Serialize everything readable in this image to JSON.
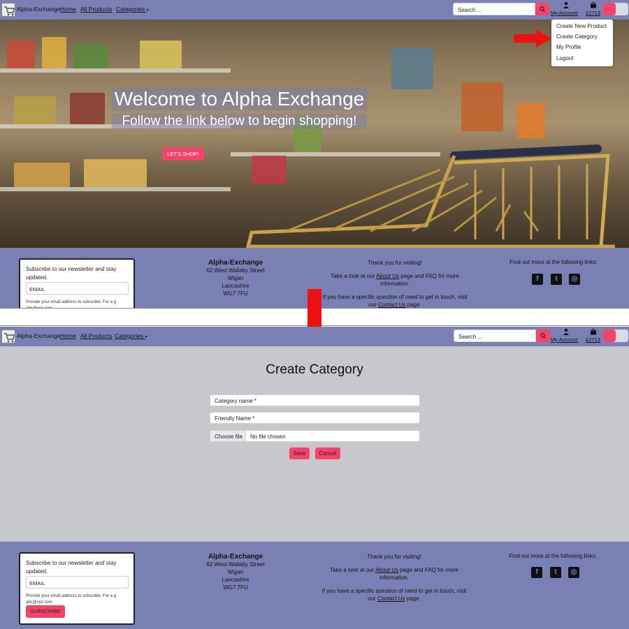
{
  "nav": {
    "brand": "Alpha-Exchange",
    "links": [
      "Home",
      "All Products",
      "Categories"
    ],
    "search_placeholder": "Search ...",
    "account_label": "My Account",
    "bag_label": "£2713"
  },
  "dropdown": {
    "items": [
      "Create New Product",
      "Create Category",
      "My Profile",
      "Logout"
    ]
  },
  "hero": {
    "title": "Welcome to Alpha Exchange",
    "subtitle": "Follow the link below to begin shopping!",
    "button": "LET'S SHOP!"
  },
  "footer": {
    "newsletter_title": "Subscribe to our newsletter and stay updated.",
    "email_placeholder": "EMAIL",
    "newsletter_help_top": "Provide your email address to subscribe. For e.g abc@xyz.com",
    "newsletter_help": "Provide your email address to subscribe. For e.g abc@xyz.com",
    "subscribe_label": "SUBSCRIBE",
    "company": "Alpha-Exchange",
    "address": [
      "62 West Wallaby Street",
      "Wigan",
      "Lancashire",
      "WG7 7FU"
    ],
    "thanks": "Thank you for visiting!",
    "about_pre": "Take a look at our",
    "about_link": "About Us",
    "about_post": "page and FAQ for more information.",
    "contact_pre": "If you have a specific question of need to get in touch, visit our",
    "contact_link": "Contact Us",
    "contact_post": "page.",
    "links_title": "Find out more at the following links:",
    "social_icons": [
      "facebook-icon",
      "twitter-icon",
      "instagram-icon"
    ]
  },
  "create_category": {
    "title": "Create Category",
    "name_placeholder": "Category name *",
    "friendly_placeholder": "Friendly Name *",
    "file_button": "Choose file",
    "file_status": "No file chosen",
    "save_label": "Save",
    "cancel_label": "Cancel"
  },
  "colors": {
    "nav_bg": "#7a80b4",
    "accent": "#f5436a",
    "main_bg": "#c6c8cc",
    "arrow": "#ee1111"
  }
}
